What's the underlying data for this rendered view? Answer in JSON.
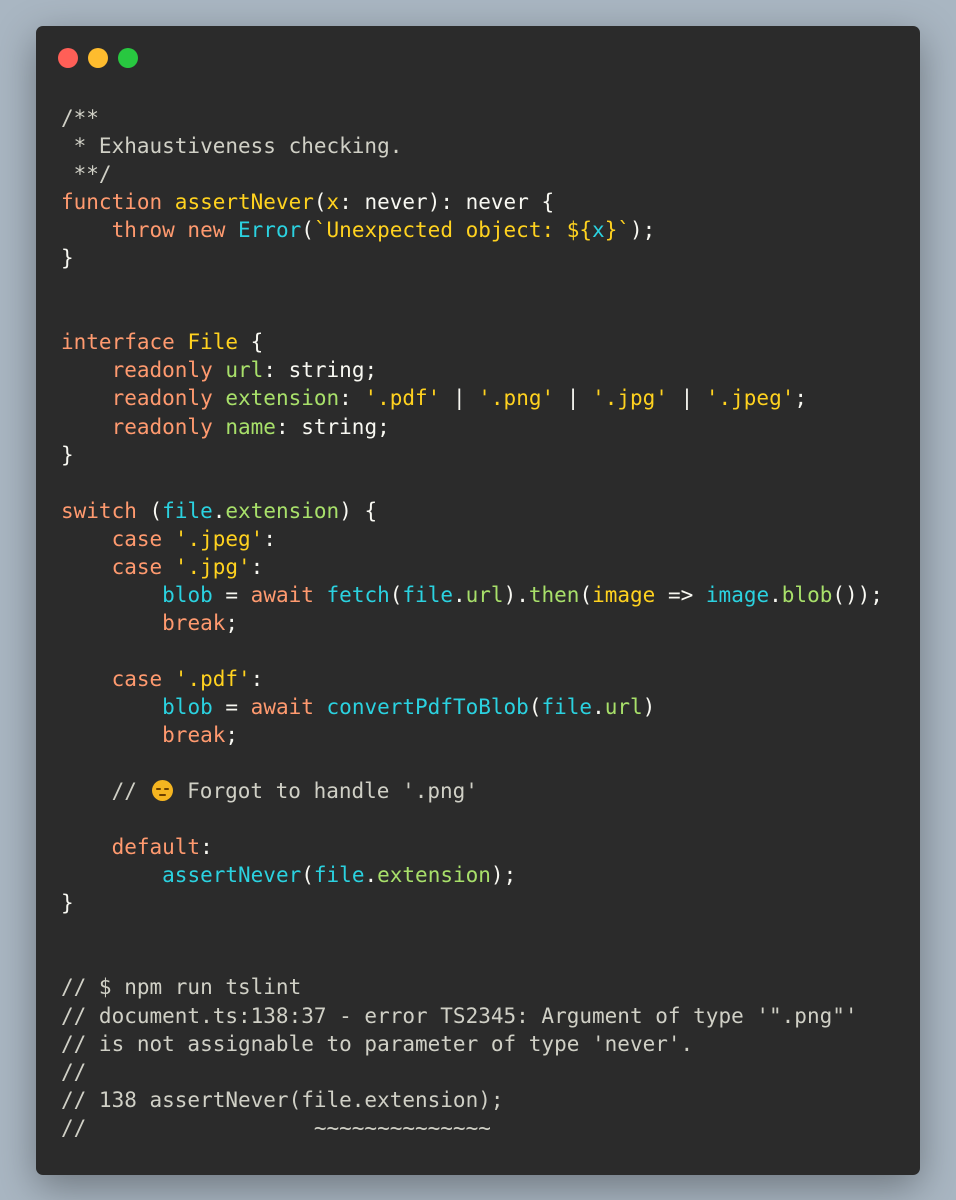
{
  "window": {
    "lights": [
      "close",
      "minimize",
      "zoom"
    ]
  },
  "code": {
    "lines": [
      [
        [
          "comment",
          "/**"
        ]
      ],
      [
        [
          "comment",
          " * Exhaustiveness checking."
        ]
      ],
      [
        [
          "comment",
          " **/"
        ]
      ],
      [
        [
          "keyword",
          "function "
        ],
        [
          "fname",
          "assertNever"
        ],
        [
          "plain",
          "("
        ],
        [
          "param",
          "x"
        ],
        [
          "plain",
          ": never): never {"
        ]
      ],
      [
        [
          "plain",
          "    "
        ],
        [
          "keyword",
          "throw new "
        ],
        [
          "class",
          "Error"
        ],
        [
          "plain",
          "("
        ],
        [
          "string",
          "`Unexpected object: ${"
        ],
        [
          "var",
          "x"
        ],
        [
          "string",
          "}`"
        ],
        [
          "plain",
          ");"
        ]
      ],
      [
        [
          "plain",
          "}"
        ]
      ],
      [],
      [],
      [
        [
          "keyword",
          "interface "
        ],
        [
          "fname",
          "File"
        ],
        [
          "plain",
          " {"
        ]
      ],
      [
        [
          "plain",
          "    "
        ],
        [
          "keyword",
          "readonly "
        ],
        [
          "prop",
          "url"
        ],
        [
          "plain",
          ": string;"
        ]
      ],
      [
        [
          "plain",
          "    "
        ],
        [
          "keyword",
          "readonly "
        ],
        [
          "prop",
          "extension"
        ],
        [
          "plain",
          ": "
        ],
        [
          "string",
          "'.pdf'"
        ],
        [
          "plain",
          " | "
        ],
        [
          "string",
          "'.png'"
        ],
        [
          "plain",
          " | "
        ],
        [
          "string",
          "'.jpg'"
        ],
        [
          "plain",
          " | "
        ],
        [
          "string",
          "'.jpeg'"
        ],
        [
          "plain",
          ";"
        ]
      ],
      [
        [
          "plain",
          "    "
        ],
        [
          "keyword",
          "readonly "
        ],
        [
          "prop",
          "name"
        ],
        [
          "plain",
          ": string;"
        ]
      ],
      [
        [
          "plain",
          "}"
        ]
      ],
      [],
      [
        [
          "keyword",
          "switch "
        ],
        [
          "plain",
          "("
        ],
        [
          "var",
          "file"
        ],
        [
          "plain",
          "."
        ],
        [
          "prop",
          "extension"
        ],
        [
          "plain",
          ") {"
        ]
      ],
      [
        [
          "plain",
          "    "
        ],
        [
          "keyword",
          "case "
        ],
        [
          "string",
          "'.jpeg'"
        ],
        [
          "plain",
          ":"
        ]
      ],
      [
        [
          "plain",
          "    "
        ],
        [
          "keyword",
          "case "
        ],
        [
          "string",
          "'.jpg'"
        ],
        [
          "plain",
          ":"
        ]
      ],
      [
        [
          "plain",
          "        "
        ],
        [
          "var",
          "blob"
        ],
        [
          "plain",
          " = "
        ],
        [
          "keyword",
          "await "
        ],
        [
          "var",
          "fetch"
        ],
        [
          "plain",
          "("
        ],
        [
          "var",
          "file"
        ],
        [
          "plain",
          "."
        ],
        [
          "prop",
          "url"
        ],
        [
          "plain",
          ")."
        ],
        [
          "prop",
          "then"
        ],
        [
          "plain",
          "("
        ],
        [
          "param",
          "image"
        ],
        [
          "plain",
          " => "
        ],
        [
          "var",
          "image"
        ],
        [
          "plain",
          "."
        ],
        [
          "prop",
          "blob"
        ],
        [
          "plain",
          "());"
        ]
      ],
      [
        [
          "plain",
          "        "
        ],
        [
          "keyword",
          "break"
        ],
        [
          "plain",
          ";"
        ]
      ],
      [],
      [
        [
          "plain",
          "    "
        ],
        [
          "keyword",
          "case "
        ],
        [
          "string",
          "'.pdf'"
        ],
        [
          "plain",
          ":"
        ]
      ],
      [
        [
          "plain",
          "        "
        ],
        [
          "var",
          "blob"
        ],
        [
          "plain",
          " = "
        ],
        [
          "keyword",
          "await "
        ],
        [
          "var",
          "convertPdfToBlob"
        ],
        [
          "plain",
          "("
        ],
        [
          "var",
          "file"
        ],
        [
          "plain",
          "."
        ],
        [
          "prop",
          "url"
        ],
        [
          "plain",
          ")"
        ]
      ],
      [
        [
          "plain",
          "        "
        ],
        [
          "keyword",
          "break"
        ],
        [
          "plain",
          ";"
        ]
      ],
      [],
      [
        [
          "comment",
          "    // "
        ],
        [
          "emoji",
          "pensive-face"
        ],
        [
          "comment",
          " Forgot to handle '.png'"
        ]
      ],
      [],
      [
        [
          "plain",
          "    "
        ],
        [
          "keyword",
          "default"
        ],
        [
          "plain",
          ":"
        ]
      ],
      [
        [
          "plain",
          "        "
        ],
        [
          "var",
          "assertNever"
        ],
        [
          "plain",
          "("
        ],
        [
          "var",
          "file"
        ],
        [
          "plain",
          "."
        ],
        [
          "prop",
          "extension"
        ],
        [
          "plain",
          ");"
        ]
      ],
      [
        [
          "plain",
          "}"
        ]
      ],
      [],
      [],
      [
        [
          "comment",
          "// $ npm run tslint"
        ]
      ],
      [
        [
          "comment",
          "// document.ts:138:37 - error TS2345: Argument of type '\".png\"'"
        ]
      ],
      [
        [
          "comment",
          "// is not assignable to parameter of type 'never'."
        ]
      ],
      [
        [
          "comment",
          "//"
        ]
      ],
      [
        [
          "comment",
          "// 138 assertNever(file.extension);"
        ]
      ],
      [
        [
          "comment",
          "//                  ~~~~~~~~~~~~~~"
        ]
      ]
    ]
  }
}
